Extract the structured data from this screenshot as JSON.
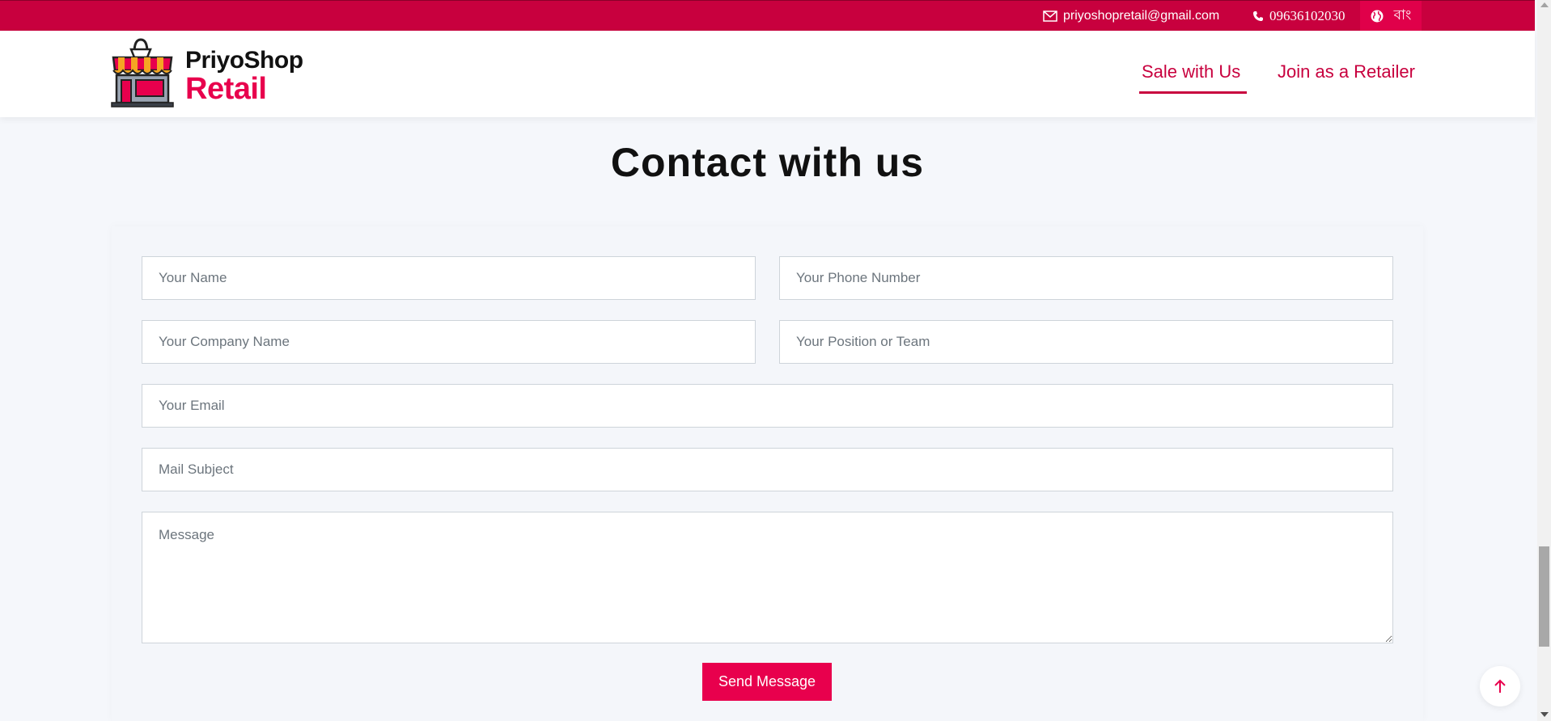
{
  "topbar": {
    "email": "priyoshopretail@gmail.com",
    "phone": "09636102030",
    "language": "বাং"
  },
  "header": {
    "logo_line1": "PriyoShop",
    "logo_line2": "Retail",
    "nav": [
      {
        "label": "Sale with Us",
        "active": true
      },
      {
        "label": "Join as a Retailer",
        "active": false
      }
    ]
  },
  "main": {
    "title": "Contact with us"
  },
  "form": {
    "name_placeholder": "Your Name",
    "phone_placeholder": "Your Phone Number",
    "company_placeholder": "Your Company Name",
    "position_placeholder": "Your Position or Team",
    "email_placeholder": "Your Email",
    "subject_placeholder": "Mail Subject",
    "message_placeholder": "Message",
    "submit_label": "Send Message"
  },
  "colors": {
    "brand": "#c8003e",
    "accent": "#e8004d",
    "background": "#f5f7fb"
  },
  "icons": {
    "email": "envelope-icon",
    "phone": "phone-icon",
    "language": "globe-icon",
    "scroll_top": "arrow-up-icon"
  }
}
